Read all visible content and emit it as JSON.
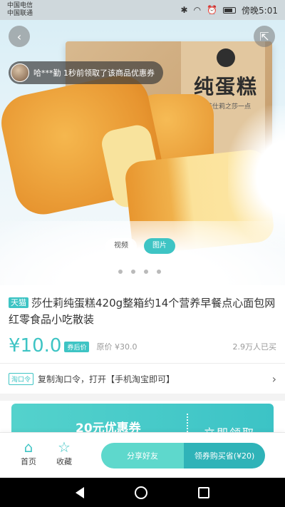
{
  "status_bar": {
    "carrier_1": "中国电信",
    "carrier_2": "中国联通",
    "time": "傍晚5:01"
  },
  "hero": {
    "box_title": "纯蛋糕",
    "box_subtitle": "莎仕莉之莎一点",
    "claim_notice": "哈***勤 1秒前领取了该商品优惠券",
    "media_tabs": {
      "video": "视频",
      "photo": "图片"
    }
  },
  "product": {
    "platform_tag": "天猫",
    "title": "莎仕莉纯蛋糕420g整箱约14个营养早餐点心面包网红零食品小吃散装",
    "price": "¥10.0",
    "price_tag": "券后价",
    "original_price": "原价 ¥30.0",
    "sold_count": "2.9万人已买"
  },
  "taokouling": {
    "tag": "淘口令",
    "text": "复制淘口令，打开【手机淘宝即可】"
  },
  "coupon": {
    "amount": "20元优惠券",
    "claim_label": "立即领取"
  },
  "bottom_bar": {
    "home_label": "首页",
    "favorite_label": "收藏",
    "share_label": "分享好友",
    "buy_label": "领券购买省(¥20)"
  },
  "colors": {
    "accent": "#3ec4c4",
    "accent_dark": "#2fb3b8",
    "accent_light": "#5ed8cc"
  },
  "icons": [
    "back-icon",
    "share-icon",
    "home-icon",
    "star-icon",
    "chevron-right-icon"
  ]
}
